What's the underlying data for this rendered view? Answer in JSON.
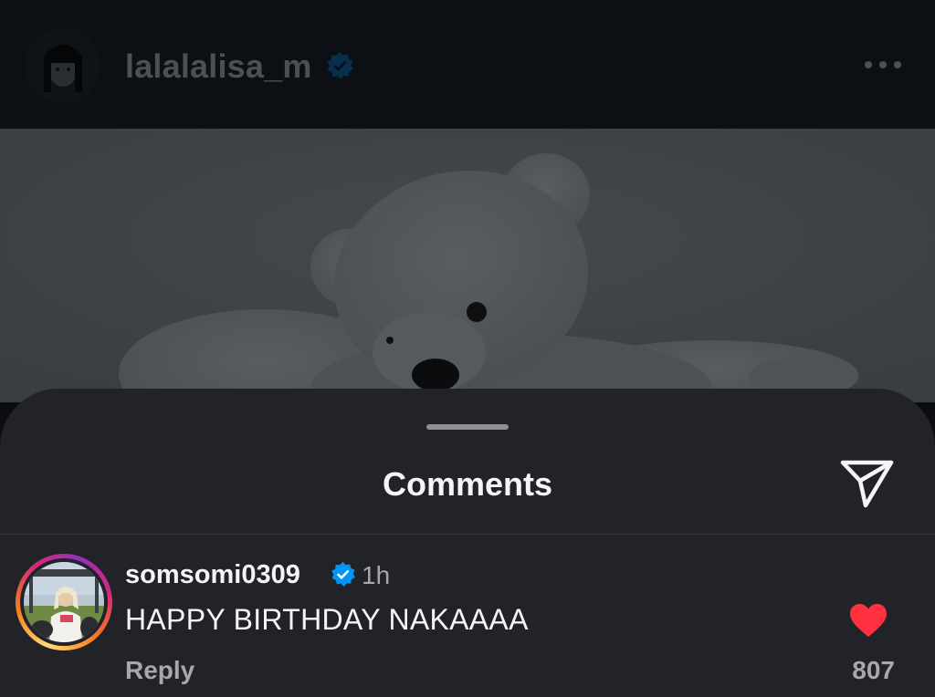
{
  "post": {
    "username": "lalalalisa_m",
    "verified_icon": "verified-badge-icon",
    "more_icon": "more-options-icon"
  },
  "comments_sheet": {
    "title": "Comments",
    "share_icon": "send-icon"
  },
  "comments": [
    {
      "username": "somsomi0309",
      "verified": true,
      "time": "1h",
      "text": "HAPPY BIRTHDAY NAKAAAA",
      "reply_label": "Reply",
      "likes": "807",
      "liked": true
    }
  ],
  "colors": {
    "verified_blue": "#0095f6",
    "like_red": "#ff3040",
    "sheet_bg": "#212328",
    "muted_text": "#a8a8a8"
  }
}
